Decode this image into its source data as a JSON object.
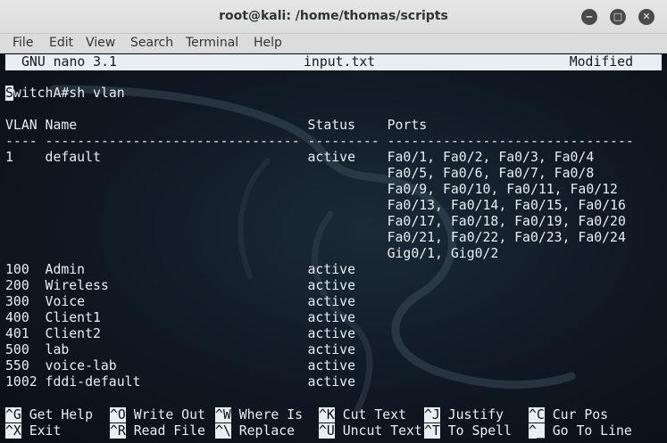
{
  "window": {
    "title": "root@kali: /home/thomas/scripts",
    "minimize_glyph": "‒",
    "maximize_glyph": "□",
    "close_glyph": "✕"
  },
  "menu": [
    "File",
    "Edit",
    "View",
    "Search",
    "Terminal",
    "Help"
  ],
  "nano": {
    "version": "GNU nano 3.1",
    "filename": "input.txt",
    "state": "Modified"
  },
  "content": {
    "cursor_char": "S",
    "lines": [
      "witchA#sh vlan",
      "",
      "VLAN Name                             Status    Ports",
      "---- -------------------------------- --------- -------------------------------",
      "1    default                          active    Fa0/1, Fa0/2, Fa0/3, Fa0/4",
      "                                                Fa0/5, Fa0/6, Fa0/7, Fa0/8",
      "                                                Fa0/9, Fa0/10, Fa0/11, Fa0/12",
      "                                                Fa0/13, Fa0/14, Fa0/15, Fa0/16",
      "                                                Fa0/17, Fa0/18, Fa0/19, Fa0/20",
      "                                                Fa0/21, Fa0/22, Fa0/23, Fa0/24",
      "                                                Gig0/1, Gig0/2",
      "100  Admin                            active",
      "200  Wireless                         active",
      "300  Voice                            active",
      "400  Client1                          active",
      "401  Client2                          active",
      "500  lab                              active",
      "550  voice-lab                        active",
      "1002 fddi-default                     active"
    ]
  },
  "shortcuts": [
    {
      "key": "^G",
      "label": " Get Help"
    },
    {
      "key": "^O",
      "label": " Write Out"
    },
    {
      "key": "^W",
      "label": " Where Is"
    },
    {
      "key": "^K",
      "label": " Cut Text"
    },
    {
      "key": "^J",
      "label": " Justify"
    },
    {
      "key": "^C",
      "label": " Cur Pos"
    },
    {
      "key": "^X",
      "label": " Exit"
    },
    {
      "key": "^R",
      "label": " Read File"
    },
    {
      "key": "^\\",
      "label": " Replace"
    },
    {
      "key": "^U",
      "label": " Uncut Text"
    },
    {
      "key": "^T",
      "label": " To Spell"
    },
    {
      "key": "^_",
      "label": " Go To Line"
    }
  ]
}
